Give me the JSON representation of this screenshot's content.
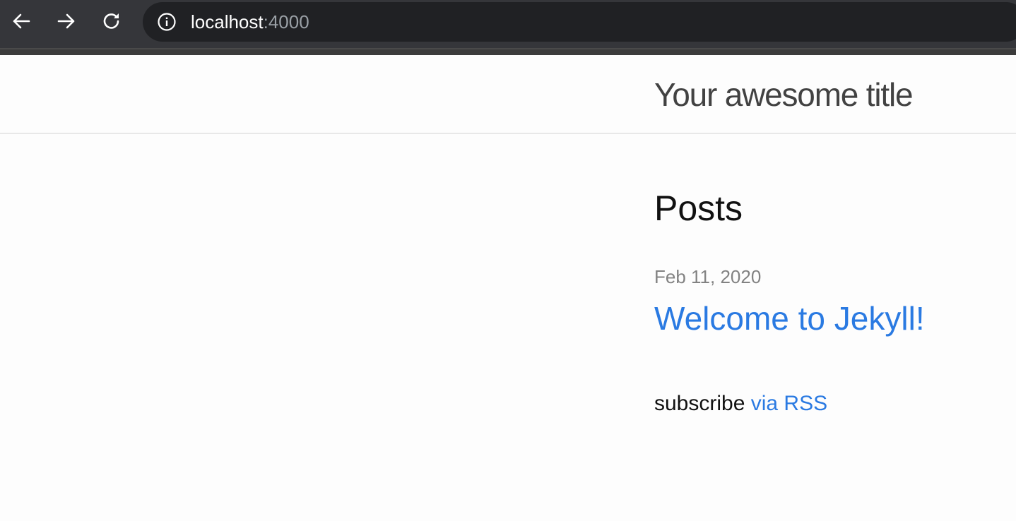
{
  "browser": {
    "url_host": "localhost",
    "url_port": ":4000",
    "icons": {
      "back": "arrow-left-icon",
      "forward": "arrow-right-icon",
      "reload": "reload-icon",
      "site_info": "info-icon"
    }
  },
  "header": {
    "site_title": "Your awesome title"
  },
  "main": {
    "heading": "Posts",
    "posts": [
      {
        "date": "Feb 11, 2020",
        "title": "Welcome to Jekyll!"
      }
    ],
    "rss": {
      "prefix": "subscribe",
      "link_label": "via RSS"
    }
  },
  "colors": {
    "link": "#2a7ae2",
    "meta": "#828282",
    "title": "#424242",
    "toolbar": "#35363a",
    "address_bar": "#202124"
  }
}
